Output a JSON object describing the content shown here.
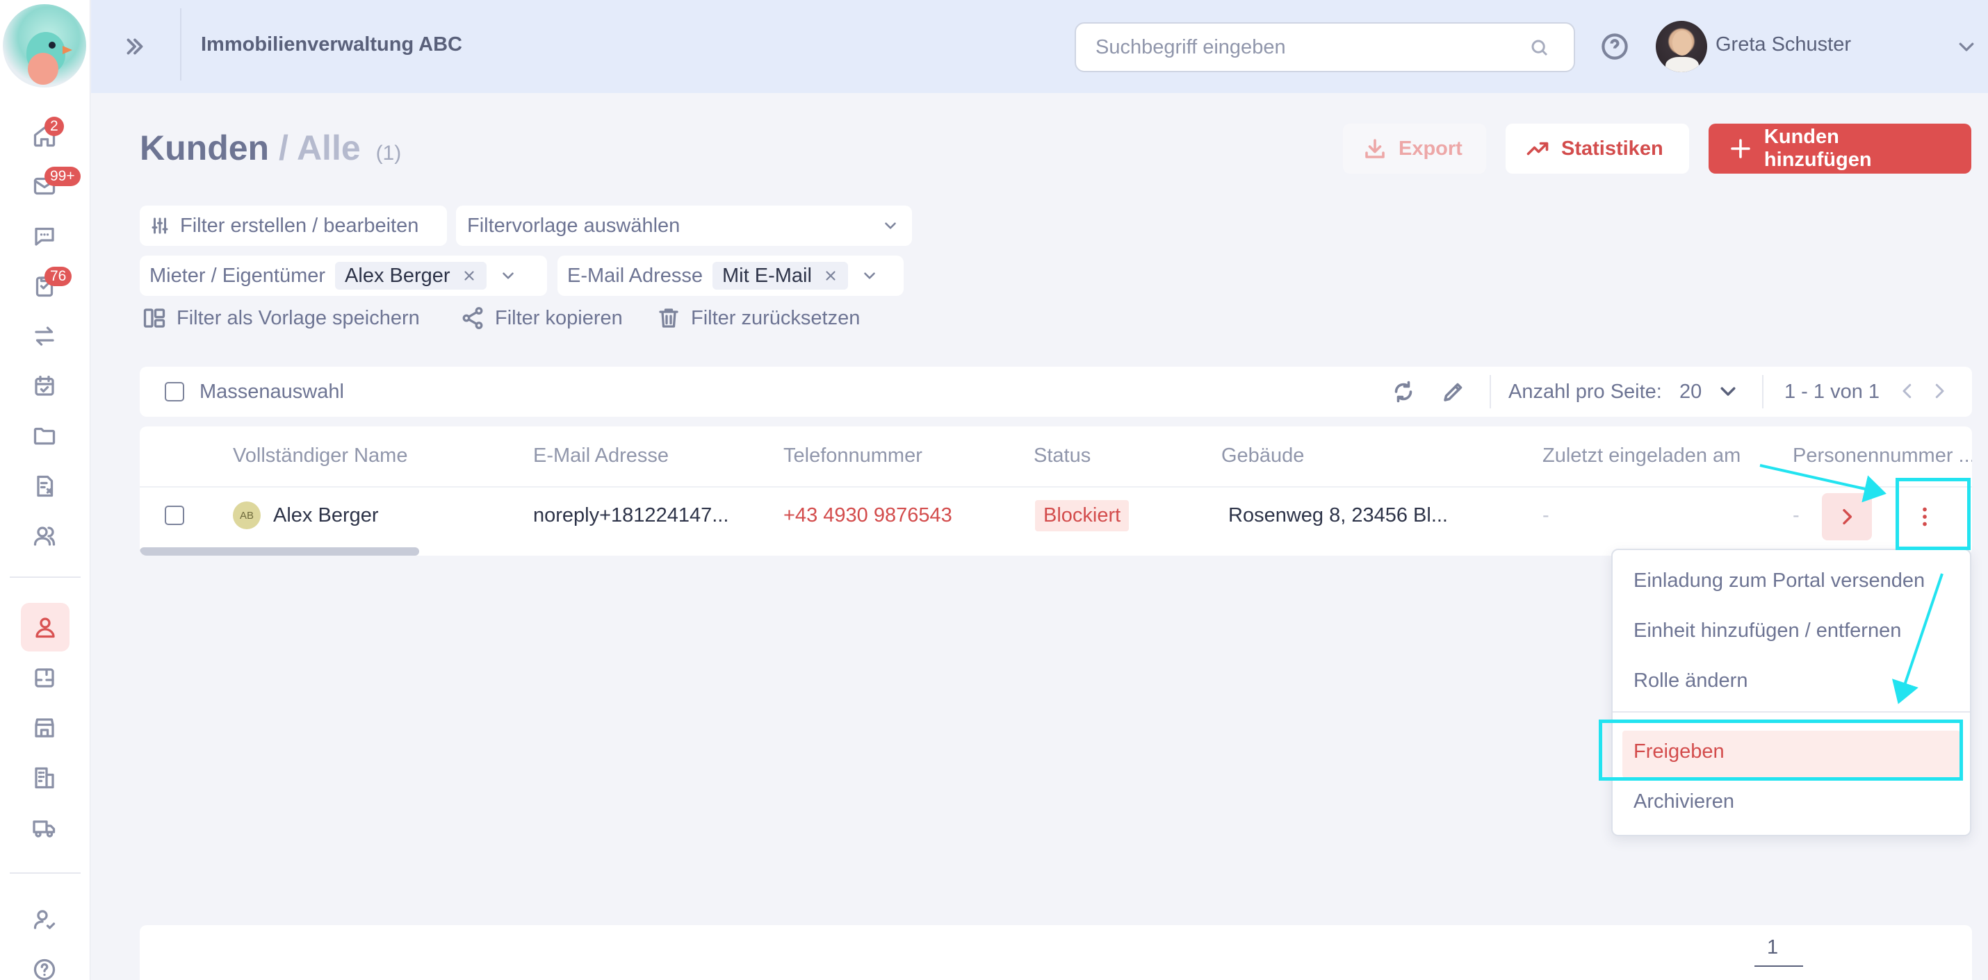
{
  "sidebar": {
    "badges": {
      "home": "2",
      "mail": "99+",
      "tasks": "76"
    }
  },
  "header": {
    "company": "Immobilienverwaltung ABC",
    "search_placeholder": "Suchbegriff eingeben",
    "user_name": "Greta Schuster"
  },
  "page": {
    "title": "Kunden",
    "separator": "/",
    "subtitle": "Alle",
    "count": "(1)",
    "export_label": "Export",
    "stats_label": "Statistiken",
    "add_label": "Kunden hinzufügen"
  },
  "filters": {
    "edit_label": "Filter erstellen / bearbeiten",
    "template_placeholder": "Filtervorlage auswählen",
    "group1_label": "Mieter / Eigentümer",
    "group1_value": "Alex Berger",
    "group2_label": "E-Mail Adresse",
    "group2_value": "Mit E-Mail",
    "save_template": "Filter als Vorlage speichern",
    "copy": "Filter kopieren",
    "reset": "Filter zurücksetzen"
  },
  "toolbar": {
    "mass_select": "Massenauswahl",
    "per_page_label": "Anzahl pro Seite:",
    "per_page_value": "20",
    "range": "1 - 1 von 1"
  },
  "table": {
    "columns": [
      "Vollständiger Name",
      "E-Mail Adresse",
      "Telefonnummer",
      "Status",
      "Gebäude",
      "Zuletzt eingeladen am",
      "Personennummer ..."
    ],
    "rows": [
      {
        "initials": "AB",
        "name": "Alex Berger",
        "email": "noreply+181224147...",
        "phone": "+43 4930 9876543",
        "status": "Blockiert",
        "building": "Rosenweg 8, 23456 Bl...",
        "last_invited": "-",
        "person_number": "-"
      }
    ]
  },
  "menu": {
    "items": [
      "Einladung zum Portal versenden",
      "Einheit hinzufügen / entfernen",
      "Rolle ändern",
      "Freigeben",
      "Archivieren"
    ]
  },
  "pagination": {
    "current": "1"
  },
  "colors": {
    "accent": "#dd4f4f",
    "annotation": "#22e3f0",
    "header_bg": "#e4ebfa"
  }
}
